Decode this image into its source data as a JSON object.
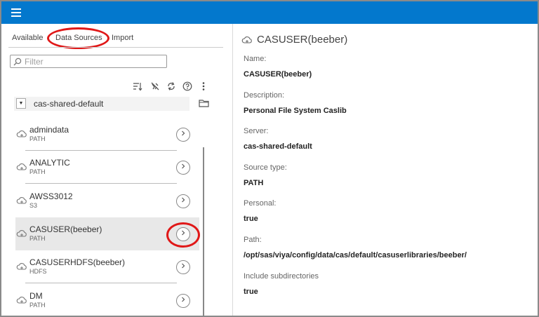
{
  "header": {
    "menu_icon": "hamburger-icon"
  },
  "tabs": [
    {
      "label": "Available"
    },
    {
      "label": "Data Sources"
    },
    {
      "label": "Import"
    }
  ],
  "filter": {
    "placeholder": "Filter",
    "value": ""
  },
  "toolbar": [
    {
      "icon": "sort-icon"
    },
    {
      "icon": "disconnect-icon"
    },
    {
      "icon": "refresh-icon"
    },
    {
      "icon": "help-icon"
    },
    {
      "icon": "more-icon"
    }
  ],
  "server": {
    "name": "cas-shared-default"
  },
  "caslibs": [
    {
      "name": "admindata",
      "type": "PATH",
      "selected": false
    },
    {
      "name": "ANALYTIC",
      "type": "PATH",
      "selected": false
    },
    {
      "name": "AWSS3012",
      "type": "S3",
      "selected": false
    },
    {
      "name": "CASUSER(beeber)",
      "type": "PATH",
      "selected": true
    },
    {
      "name": "CASUSERHDFS(beeber)",
      "type": "HDFS",
      "selected": false
    },
    {
      "name": "DM",
      "type": "PATH",
      "selected": false
    }
  ],
  "details": {
    "title": "CASUSER(beeber)",
    "fields": [
      {
        "label": "Name:",
        "value": "CASUSER(beeber)"
      },
      {
        "label": "Description:",
        "value": "Personal File System Caslib"
      },
      {
        "label": "Server:",
        "value": "cas-shared-default"
      },
      {
        "label": "Source type:",
        "value": "PATH"
      },
      {
        "label": "Personal:",
        "value": "true"
      },
      {
        "label": "Path:",
        "value": "/opt/sas/viya/config/data/cas/default/casuserlibraries/beeber/"
      },
      {
        "label": "Include subdirectories",
        "value": "true"
      }
    ]
  },
  "colors": {
    "header": "#0378cd",
    "annotation": "#e01818",
    "selected_row": "#e8e8e8"
  }
}
